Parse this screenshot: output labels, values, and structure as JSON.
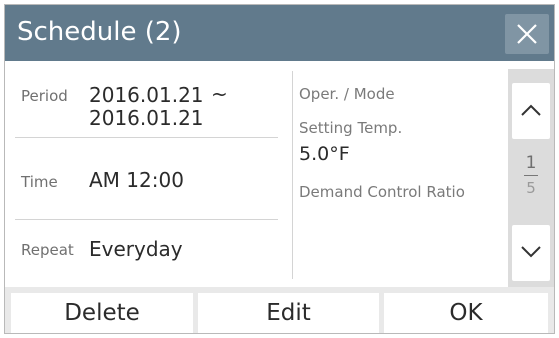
{
  "dialog": {
    "title": "Schedule (2)",
    "close_icon": "close-icon"
  },
  "details": {
    "period_label": "Period",
    "period_start": "2016.01.21",
    "period_sep": "~",
    "period_end": "2016.01.21",
    "time_label": "Time",
    "time_value": "AM 12:00",
    "repeat_label": "Repeat",
    "repeat_value": "Everyday"
  },
  "settings": {
    "mode_label": "Oper. / Mode",
    "temp_label": "Setting Temp.",
    "temp_value": "5.0°F",
    "demand_label": "Demand Control Ratio"
  },
  "pager": {
    "current": "1",
    "total": "5",
    "up_icon": "chevron-up-icon",
    "down_icon": "chevron-down-icon"
  },
  "buttons": {
    "delete": "Delete",
    "edit": "Edit",
    "ok": "OK"
  },
  "colors": {
    "titlebar": "#617a8c",
    "close_bg": "#8095a4",
    "pager_bg": "#dcdcdc",
    "buttonbar_bg": "#e9e9e9"
  }
}
